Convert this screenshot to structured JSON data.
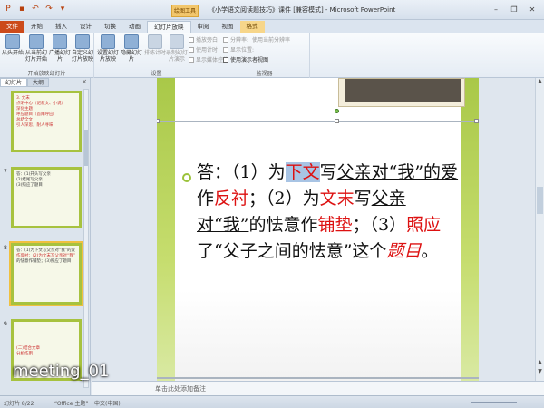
{
  "window": {
    "title": "《小学语文阅读题技巧》课件 [兼容模式] - Microsoft PowerPoint",
    "context_tab_label": "绘图工具"
  },
  "qat": {
    "icons": [
      "save-icon",
      "undo-icon",
      "redo-icon",
      "customize-icon"
    ]
  },
  "window_buttons": {
    "minimize": "–",
    "restore": "❐",
    "close": "✕"
  },
  "ribbon_tabs": [
    "文件",
    "开始",
    "插入",
    "设计",
    "切换",
    "动画",
    "幻灯片放映",
    "审阅",
    "视图",
    "格式"
  ],
  "ribbon": {
    "group1": {
      "label": "开始放映幻灯片",
      "buttons": [
        "从头开始",
        "从当前幻灯片开始",
        "广播幻灯片",
        "自定义幻灯片放映"
      ]
    },
    "group2": {
      "label": "设置",
      "buttons": [
        "设置幻灯片放映",
        "隐藏幻灯片",
        "排练计时",
        "录制幻灯片演示"
      ],
      "checks": [
        "播放旁白",
        "使用计时",
        "显示媒体控件"
      ]
    },
    "group3": {
      "label": "监视器",
      "checks": [
        "分辨率:",
        "显示位置:",
        "使用演示者视图"
      ],
      "dropdown": "使用当前分辨率"
    }
  },
  "panel": {
    "tabs": [
      "幻灯片",
      "大纲"
    ],
    "close": "×",
    "thumbs": [
      {
        "num": "",
        "lines": [
          "3. 文末",
          "点明中心（记叙文、小说）",
          "深化主题",
          "呼应题目（首尾呼应）",
          "总结全文",
          "引人深思，耐人寻味"
        ]
      },
      {
        "num": "7",
        "lines": [
          "答：(1)开头写父亲",
          "(2)结尾写父亲",
          "(3)照应了题目"
        ]
      },
      {
        "num": "8",
        "lines": [
          "答：(1)为下文写父亲对“我”的爱",
          "作反衬；(2)为文末写父亲对“我”",
          "的怯意作铺垫；(3)照应了题目"
        ]
      },
      {
        "num": "9",
        "lines": [
          "(二)结合文章",
          "分析作用"
        ]
      }
    ]
  },
  "slide": {
    "answer": {
      "p1": "答：（1）为",
      "k1": "下文",
      "p2": "写",
      "u1": "父亲对“我”的爱",
      "p3": "作",
      "k2": "反衬",
      "p4": "；（2）为",
      "k3": "文末",
      "p5": "写",
      "u2": "父亲对“我”",
      "p6": "的怯意作",
      "k4": "铺垫",
      "p7": "；（3）",
      "k5": "照应",
      "p8": "了“父子之间的怯意”这个",
      "k6": "题目",
      "p9": "。"
    }
  },
  "notes": {
    "placeholder": "单击此处添加备注"
  },
  "status": {
    "left": "幻灯片 8/22",
    "theme": "“Office 主题”",
    "lang": "中文(中国)"
  },
  "watermark": "meeting_01",
  "colors": {
    "file_tab": "#cc4a1a",
    "highlight_red": "#d11",
    "slide_green": "#a9c848"
  }
}
